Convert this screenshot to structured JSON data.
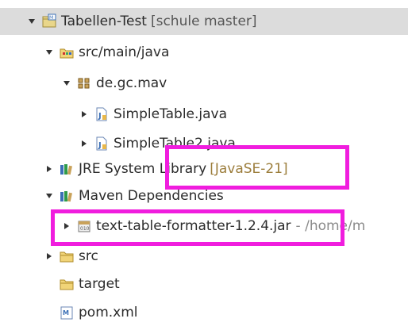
{
  "tree": {
    "project": {
      "label": "Tabellen-Test",
      "decoration": "[schule master]",
      "expanded": true,
      "icon": "project-icon"
    },
    "src_main_java": {
      "label": "src/main/java",
      "expanded": true,
      "icon": "source-folder-icon"
    },
    "package": {
      "label": "de.gc.mav",
      "expanded": true,
      "icon": "package-icon"
    },
    "file1": {
      "label": "SimpleTable.java",
      "expanded": false,
      "icon": "java-file-icon"
    },
    "file2": {
      "label": "SimpleTable2.java",
      "expanded": false,
      "icon": "java-file-icon"
    },
    "jre": {
      "label": "JRE System Library",
      "decoration": "[JavaSE-21]",
      "expanded": false,
      "icon": "library-icon"
    },
    "maven": {
      "label": "Maven Dependencies",
      "expanded": true,
      "icon": "library-icon"
    },
    "jar": {
      "label": "text-table-formatter-1.2.4.jar",
      "decoration": "- /home/m",
      "expanded": false,
      "icon": "jar-icon"
    },
    "src": {
      "label": "src",
      "expanded": false,
      "icon": "folder-icon"
    },
    "target": {
      "label": "target",
      "icon": "folder-icon"
    },
    "pom": {
      "label": "pom.xml",
      "icon": "maven-pom-icon"
    }
  },
  "highlight_color": "#f01dde",
  "selection_color": "#dcdcdc"
}
